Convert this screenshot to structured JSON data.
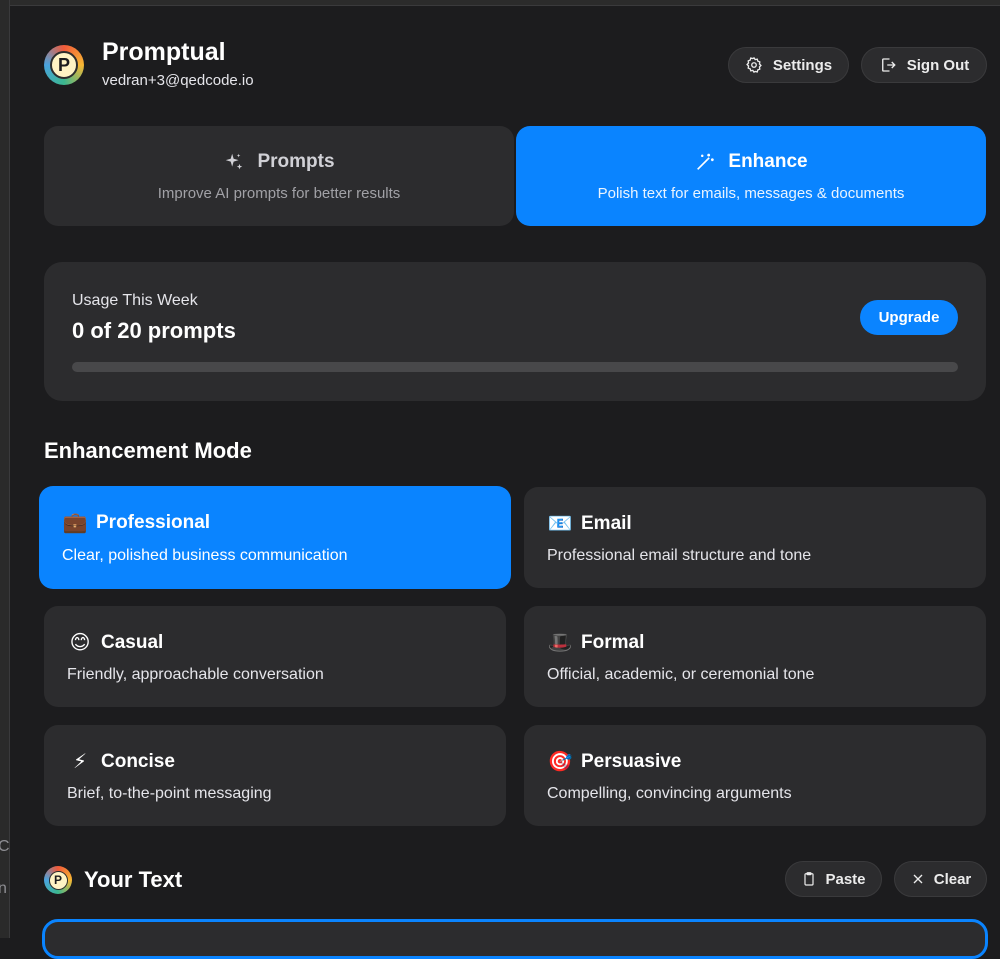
{
  "app": {
    "title": "Promptual",
    "email": "vedran+3@qedcode.io",
    "logo_letter": "P"
  },
  "header": {
    "settings_label": "Settings",
    "signout_label": "Sign Out"
  },
  "tabs": [
    {
      "label": "Prompts",
      "sub": "Improve AI prompts for better results",
      "icon": "sparkles-icon",
      "selected": false
    },
    {
      "label": "Enhance",
      "sub": "Polish text for emails, messages & documents",
      "icon": "magic-wand-icon",
      "selected": true
    }
  ],
  "usage": {
    "label": "Usage This Week",
    "count_text": "0 of 20 prompts",
    "used": 0,
    "limit": 20,
    "upgrade_label": "Upgrade"
  },
  "enhancement": {
    "title": "Enhancement Mode",
    "modes": [
      {
        "emoji": "💼",
        "label": "Professional",
        "desc": "Clear, polished business communication",
        "selected": true
      },
      {
        "emoji": "📧",
        "label": "Email",
        "desc": "Professional email structure and tone",
        "selected": false
      },
      {
        "emoji": "😊",
        "label": "Casual",
        "desc": "Friendly, approachable conversation",
        "selected": false
      },
      {
        "emoji": "🎩",
        "label": "Formal",
        "desc": "Official, academic, or ceremonial tone",
        "selected": false
      },
      {
        "emoji": "⚡",
        "label": "Concise",
        "desc": "Brief, to-the-point messaging",
        "selected": false
      },
      {
        "emoji": "🎯",
        "label": "Persuasive",
        "desc": "Compelling, convincing arguments",
        "selected": false
      }
    ]
  },
  "your_text": {
    "title": "Your Text",
    "paste_label": "Paste",
    "clear_label": "Clear"
  },
  "colors": {
    "accent": "#0a84ff",
    "background": "#1c1c1e",
    "card": "#2c2c2e"
  }
}
